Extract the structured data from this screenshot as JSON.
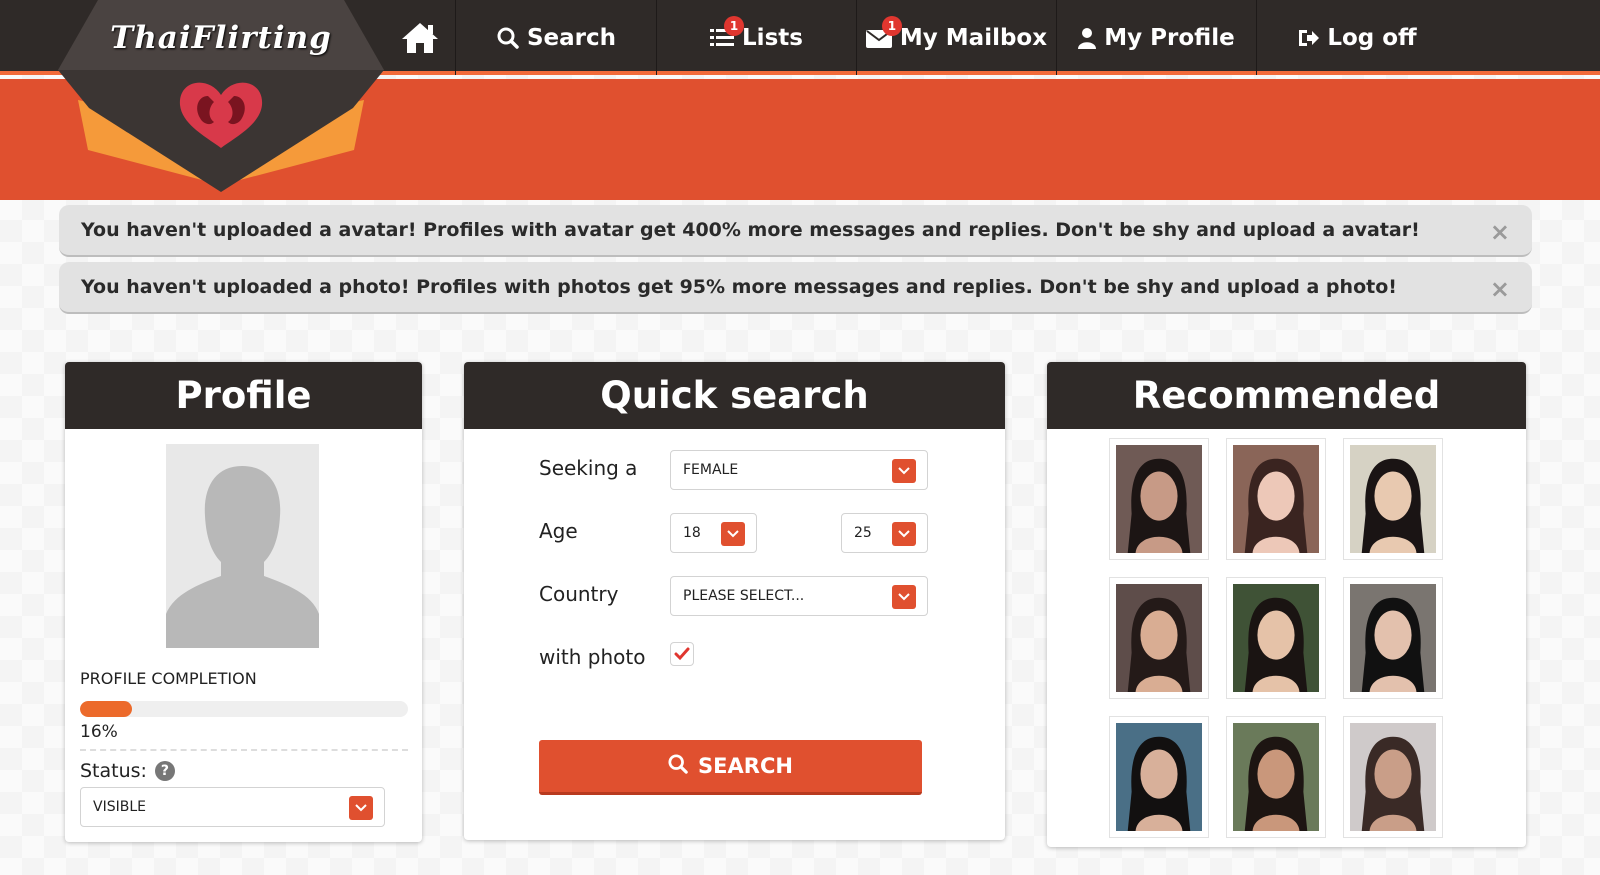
{
  "brand": {
    "logo_text": "ThaiFlirting"
  },
  "nav": {
    "search": "Search",
    "lists": "Lists",
    "lists_badge": "1",
    "mailbox": "My Mailbox",
    "mailbox_badge": "1",
    "profile": "My Profile",
    "logoff": "Log off"
  },
  "alerts": [
    {
      "text": "You haven't uploaded a avatar! Profiles with avatar get 400% more messages and replies. Don't be shy and upload a avatar!",
      "close": "×"
    },
    {
      "text": "You haven't uploaded a photo! Profiles with photos get 95% more messages and replies. Don't be shy and upload a photo!",
      "close": "×"
    }
  ],
  "profile": {
    "title": "Profile",
    "completion_label": "PROFILE COMPLETION",
    "completion_value": "16%",
    "completion_fraction": 0.16,
    "status_label": "Status:",
    "help": "?",
    "status_value": "VISIBLE"
  },
  "quick_search": {
    "title": "Quick search",
    "seeking_label": "Seeking a",
    "seeking_value": "FEMALE",
    "age_label": "Age",
    "age_from": "18",
    "age_to": "25",
    "country_label": "Country",
    "country_value": "PLEASE SELECT...",
    "photo_label": "with photo",
    "photo_checked": true,
    "button": "SEARCH"
  },
  "recommended": {
    "title": "Recommended",
    "photos": [
      {
        "bg": "#6f5a55",
        "face": "#c79a86",
        "hair": "#1c1514"
      },
      {
        "bg": "#8a6558",
        "face": "#edc8b8",
        "hair": "#3a2420"
      },
      {
        "bg": "#d6d2c4",
        "face": "#e8c9b0",
        "hair": "#1a1414"
      },
      {
        "bg": "#5e4d4a",
        "face": "#d9ad93",
        "hair": "#241a18"
      },
      {
        "bg": "#3f5236",
        "face": "#e5c2a8",
        "hair": "#1a1412"
      },
      {
        "bg": "#7a7570",
        "face": "#e3c1ad",
        "hair": "#111111"
      },
      {
        "bg": "#4a6f86",
        "face": "#d8b09a",
        "hair": "#121010"
      },
      {
        "bg": "#6a7a5a",
        "face": "#c9977b",
        "hair": "#1d1512"
      },
      {
        "bg": "#cfcaca",
        "face": "#c99e88",
        "hair": "#3a2a26"
      }
    ]
  },
  "colors": {
    "accent": "#e0502f",
    "dark": "#2f2a28"
  }
}
